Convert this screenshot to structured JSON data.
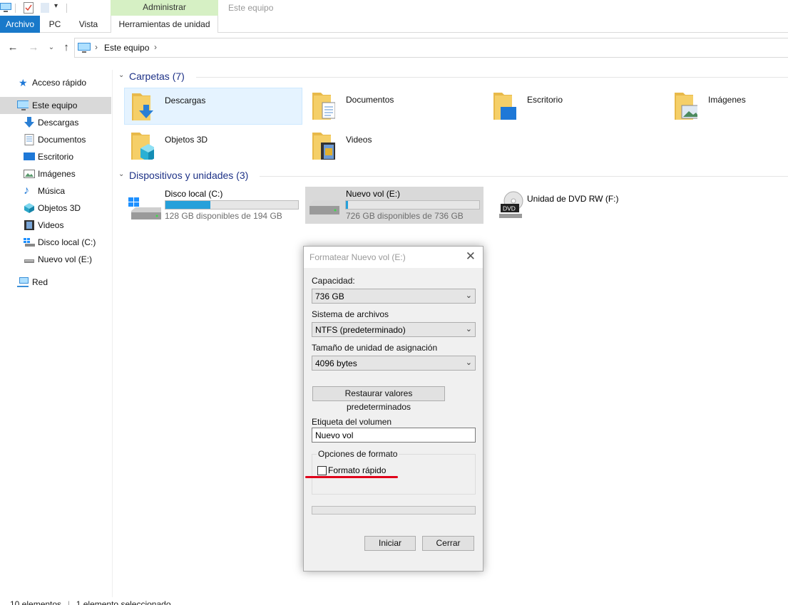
{
  "ribbon": {
    "context_group": "Administrar",
    "window_title": "Este equipo",
    "tabs": {
      "file": "Archivo",
      "pc": "PC",
      "view": "Vista",
      "tools": "Herramientas de unidad"
    }
  },
  "address": {
    "crumb": "Este equipo"
  },
  "nav": {
    "quick_access": "Acceso rápido",
    "this_pc": "Este equipo",
    "items": [
      "Descargas",
      "Documentos",
      "Escritorio",
      "Imágenes",
      "Música",
      "Objetos 3D",
      "Videos",
      "Disco local (C:)",
      "Nuevo vol (E:)"
    ],
    "network": "Red"
  },
  "folders": {
    "title": "Carpetas (7)",
    "items": [
      "Descargas",
      "Documentos",
      "Escritorio",
      "Imágenes",
      "Objetos 3D",
      "Videos"
    ]
  },
  "devices": {
    "title": "Dispositivos y unidades (3)",
    "drives": [
      {
        "name": "Disco local (C:)",
        "free": "128 GB disponibles de 194 GB",
        "used_fraction": 0.34
      },
      {
        "name": "Nuevo vol (E:)",
        "free": "726 GB disponibles de 736 GB",
        "used_fraction": 0.014
      },
      {
        "name": "Unidad de DVD RW (F:)",
        "icon": "dvd-drive-icon"
      }
    ]
  },
  "dialog": {
    "title": "Formatear Nuevo vol (E:)",
    "capacity_label": "Capacidad:",
    "capacity_value": "736 GB",
    "fs_label": "Sistema de archivos",
    "fs_value": "NTFS (predeterminado)",
    "alloc_label": "Tamaño de unidad de asignación",
    "alloc_value": "4096 bytes",
    "restore_button": "Restaurar valores predeterminados",
    "volume_label_label": "Etiqueta del volumen",
    "volume_label_value": "Nuevo vol",
    "options_title": "Opciones de formato",
    "quick_format": "Formato rápido",
    "quick_format_checked": false,
    "start_button": "Iniciar",
    "close_button": "Cerrar"
  },
  "status": {
    "count": "10 elementos",
    "selected": "1 elemento seleccionado"
  },
  "colors": {
    "accent": "#1979ca",
    "context_tab": "#d6f0c4",
    "annotation": "#e0001a",
    "bar_fill": "#26a0da"
  }
}
